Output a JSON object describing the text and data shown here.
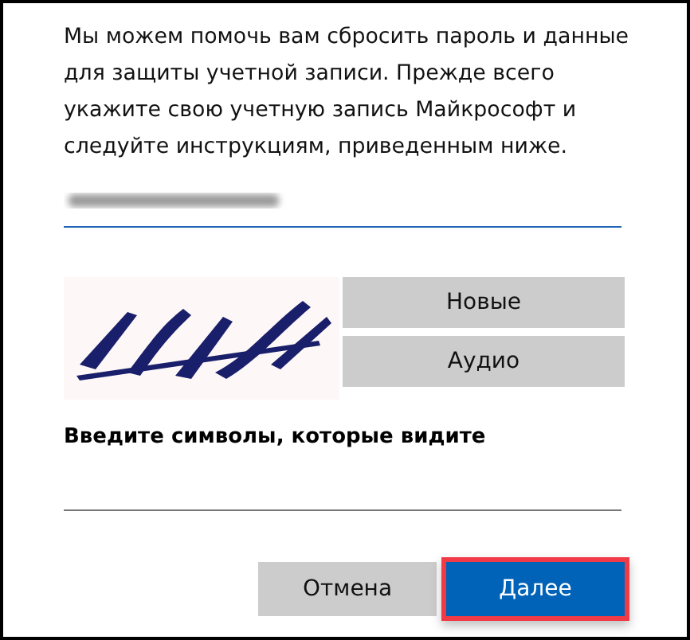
{
  "intro": "Мы можем помочь вам сбросить пароль и данные для защиты учетной записи. Прежде всего укажите свою учетную запись Майкрософт и следуйте инструкциям, приведенным ниже.",
  "account_field": {
    "kind": "blurred"
  },
  "captcha_buttons": [
    "Новые",
    "Аудио"
  ],
  "captcha_label": "Введите символы, которые видите",
  "buttons": [
    {
      "label": "Отмена",
      "kind": "secondary",
      "highlighted": false
    },
    {
      "label": "Далее",
      "kind": "primary",
      "highlighted": true
    }
  ]
}
